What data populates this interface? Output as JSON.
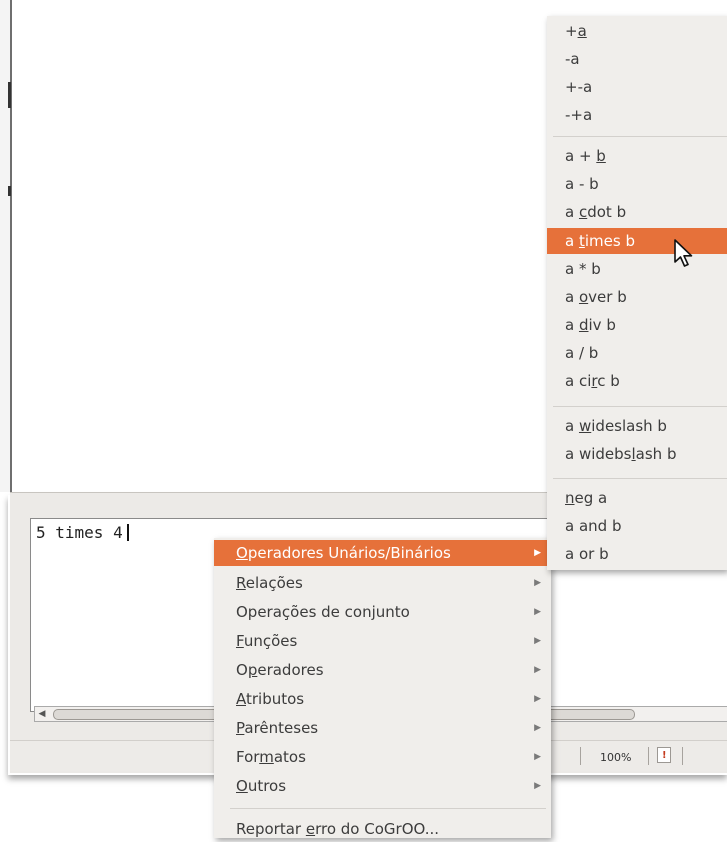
{
  "editor": {
    "text": "5 times 4"
  },
  "status": {
    "zoom": "100%"
  },
  "context_menu": {
    "items": [
      {
        "pre": "",
        "ul": "O",
        "post": "peradores Unários/Binários",
        "submenu": true,
        "highlighted": true
      },
      {
        "pre": "",
        "ul": "R",
        "post": "elações",
        "submenu": true
      },
      {
        "pre": "Operações de con",
        "ul": "j",
        "post": "unto",
        "submenu": true
      },
      {
        "pre": "",
        "ul": "F",
        "post": "unções",
        "submenu": true
      },
      {
        "pre": "O",
        "ul": "p",
        "post": "eradores",
        "submenu": true
      },
      {
        "pre": "",
        "ul": "A",
        "post": "tributos",
        "submenu": true
      },
      {
        "pre": "",
        "ul": "P",
        "post": "arênteses",
        "submenu": true
      },
      {
        "pre": "For",
        "ul": "m",
        "post": "atos",
        "submenu": true
      },
      {
        "pre": "",
        "ul": "O",
        "post": "utros",
        "submenu": true
      },
      {
        "pre": "Reportar ",
        "ul": "e",
        "post": "rro do CoGrOO...",
        "submenu": false
      }
    ]
  },
  "submenu": {
    "items": [
      {
        "pre": "+",
        "ul": "a",
        "post": ""
      },
      {
        "pre": "-a",
        "ul": "",
        "post": ""
      },
      {
        "pre": "+-a",
        "ul": "",
        "post": ""
      },
      {
        "pre": "-+a",
        "ul": "",
        "post": ""
      },
      {
        "pre": "a + ",
        "ul": "b",
        "post": ""
      },
      {
        "pre": "a - b",
        "ul": "",
        "post": ""
      },
      {
        "pre": "a ",
        "ul": "c",
        "post": "dot b"
      },
      {
        "pre": "a ",
        "ul": "t",
        "post": "imes b",
        "highlighted": true
      },
      {
        "pre": "a * b",
        "ul": "",
        "post": ""
      },
      {
        "pre": "a ",
        "ul": "o",
        "post": "ver b"
      },
      {
        "pre": "a ",
        "ul": "d",
        "post": "iv b"
      },
      {
        "pre": "a / b",
        "ul": "",
        "post": ""
      },
      {
        "pre": "a ci",
        "ul": "r",
        "post": "c b"
      },
      {
        "pre": "a ",
        "ul": "w",
        "post": "ideslash b"
      },
      {
        "pre": "a widebs",
        "ul": "l",
        "post": "ash b"
      },
      {
        "pre": "",
        "ul": "n",
        "post": "eg a"
      },
      {
        "pre": "a and b",
        "ul": "",
        "post": ""
      },
      {
        "pre": "a or b",
        "ul": "",
        "post": ""
      }
    ]
  },
  "colors": {
    "highlight": "#e6713a",
    "menu_bg": "#f0eeeb",
    "menu_text": "#3c3c3c"
  },
  "icons": {
    "submenu_arrow": "triangle-right-icon",
    "pointer": "mouse-pointer-icon"
  }
}
